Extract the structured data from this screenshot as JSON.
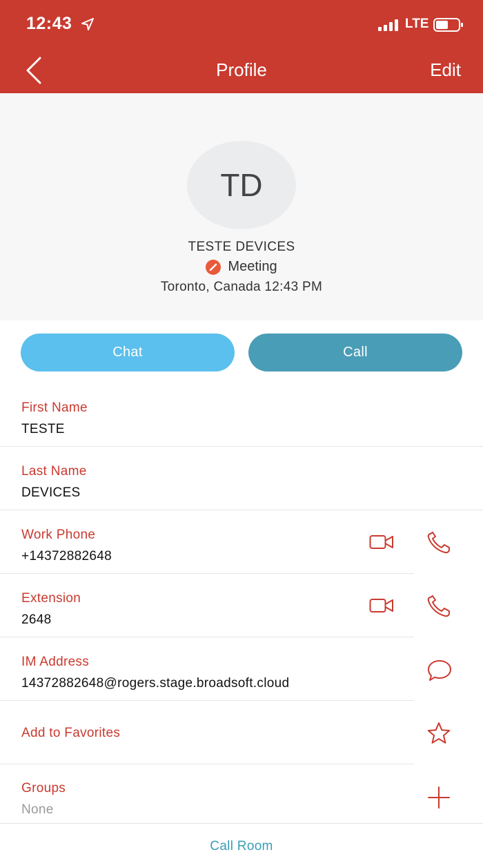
{
  "status_bar": {
    "time": "12:43",
    "network": "LTE"
  },
  "nav": {
    "title": "Profile",
    "edit_label": "Edit"
  },
  "profile": {
    "initials": "TD",
    "name": "TESTE DEVICES",
    "presence": "Meeting",
    "location": "Toronto, Canada 12:43 PM"
  },
  "actions": {
    "chat_label": "Chat",
    "call_label": "Call"
  },
  "fields": {
    "first_name": {
      "label": "First Name",
      "value": "TESTE"
    },
    "last_name": {
      "label": "Last Name",
      "value": "DEVICES"
    },
    "work_phone": {
      "label": "Work Phone",
      "value": "+14372882648"
    },
    "extension": {
      "label": "Extension",
      "value": "2648"
    },
    "im_address": {
      "label": "IM Address",
      "value": "14372882648@rogers.stage.broadsoft.cloud"
    },
    "favorites": {
      "label": "Add to Favorites"
    },
    "groups": {
      "label": "Groups",
      "value": "None"
    }
  },
  "bottom": {
    "call_room_label": "Call Room"
  },
  "colors": {
    "header": "#c93a2f",
    "accent": "#c93a2f",
    "chat": "#5bc0ed",
    "call": "#4a9db6",
    "presence": "#e95a3b"
  }
}
